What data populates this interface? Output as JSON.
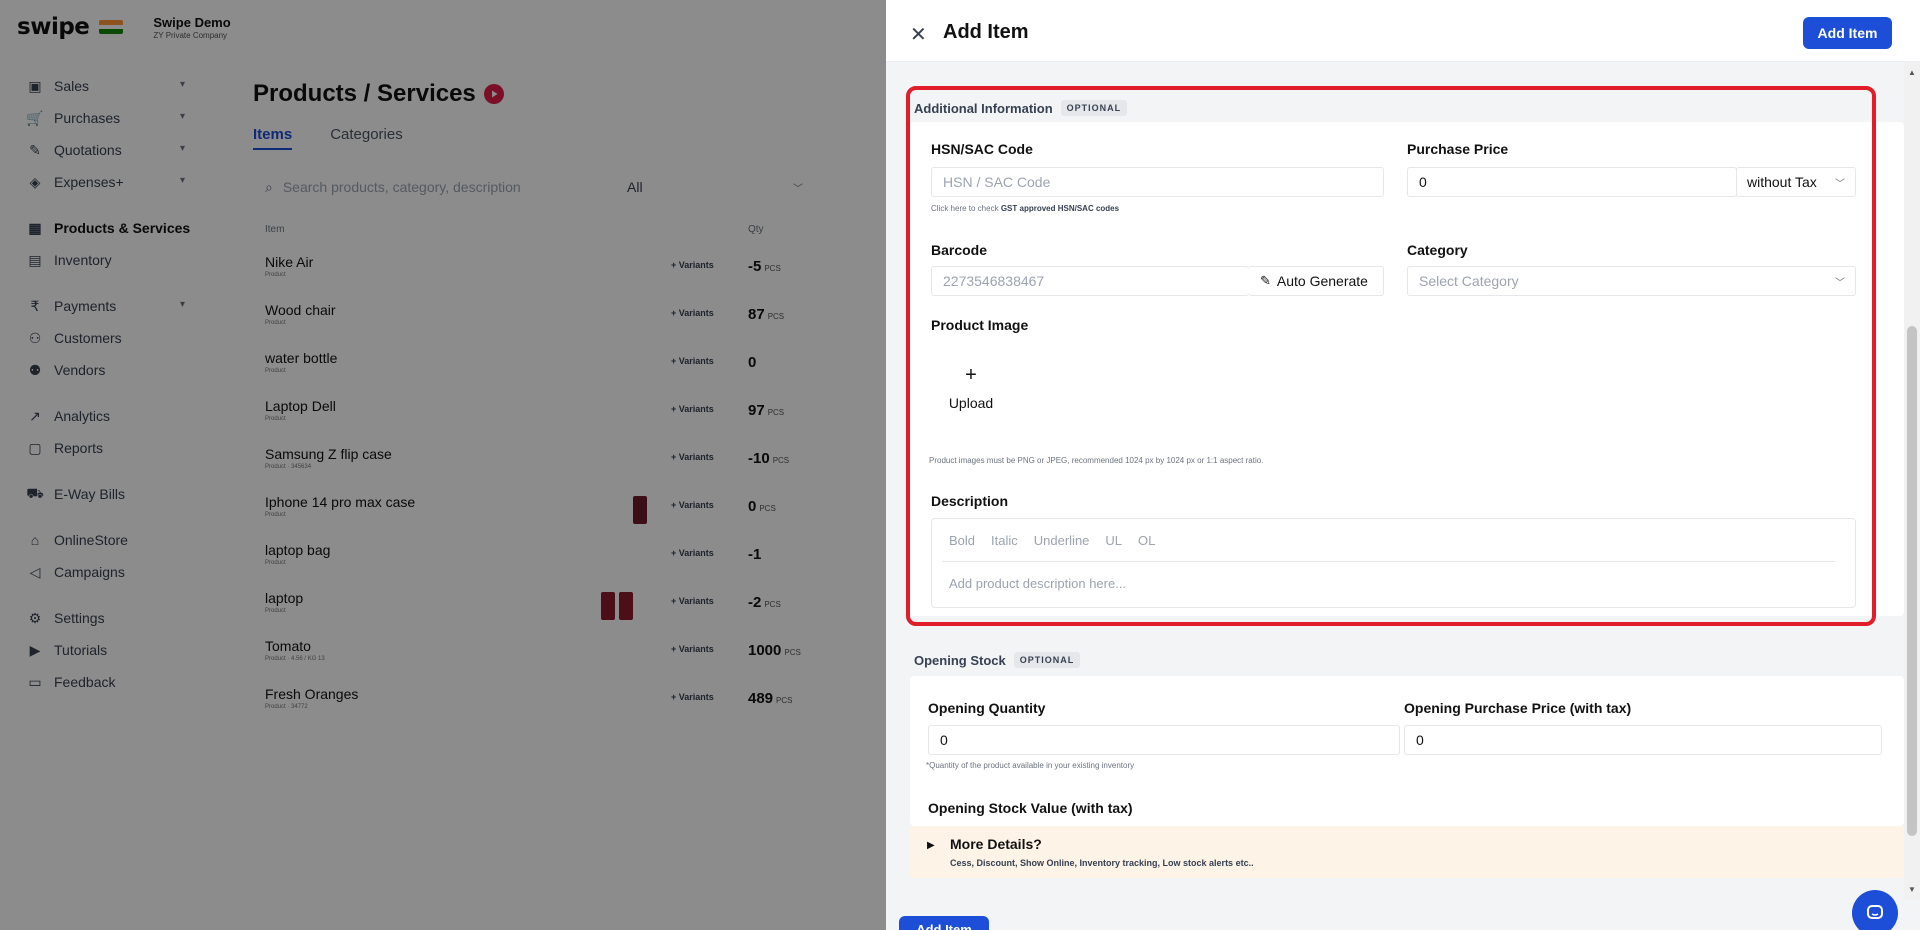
{
  "brand": {
    "logo": "swipe",
    "org_name": "Swipe Demo",
    "org_sub": "ZY Private Company"
  },
  "sidebar": {
    "items": [
      {
        "label": "Sales",
        "icon": "sales-icon",
        "chevron": true
      },
      {
        "label": "Purchases",
        "icon": "cart-icon",
        "chevron": true
      },
      {
        "label": "Quotations",
        "icon": "pen-icon",
        "chevron": true
      },
      {
        "label": "Expenses+",
        "icon": "tag-icon",
        "chevron": true
      },
      {
        "label": "Products & Services",
        "icon": "products-icon",
        "active": true
      },
      {
        "label": "Inventory",
        "icon": "inventory-icon"
      },
      {
        "label": "Payments",
        "icon": "rupee-icon",
        "chevron": true
      },
      {
        "label": "Customers",
        "icon": "user-icon"
      },
      {
        "label": "Vendors",
        "icon": "users-icon"
      },
      {
        "label": "Analytics",
        "icon": "chart-icon"
      },
      {
        "label": "Reports",
        "icon": "report-icon"
      },
      {
        "label": "E-Way Bills",
        "icon": "truck-icon"
      },
      {
        "label": "OnlineStore",
        "icon": "store-icon"
      },
      {
        "label": "Campaigns",
        "icon": "megaphone-icon"
      },
      {
        "label": "Settings",
        "icon": "gear-icon"
      },
      {
        "label": "Tutorials",
        "icon": "youtube-icon"
      },
      {
        "label": "Feedback",
        "icon": "chat-icon"
      }
    ]
  },
  "products_page": {
    "title": "Products / Services",
    "tabs": [
      "Items",
      "Categories"
    ],
    "search_placeholder": "Search products, category, description",
    "filter_value": "All",
    "columns": {
      "item": "Item",
      "qty": "Qty"
    },
    "variants_label": "+ Variants",
    "rows": [
      {
        "name": "Nike Air",
        "sub": "Product",
        "qty": "-5",
        "unit": "PCS"
      },
      {
        "name": "Wood chair",
        "sub": "Product",
        "qty": "87",
        "unit": "PCS"
      },
      {
        "name": "water bottle",
        "sub": "Product",
        "qty": "0",
        "unit": ""
      },
      {
        "name": "Laptop Dell",
        "sub": "Product",
        "qty": "97",
        "unit": "PCS"
      },
      {
        "name": "Samsung Z flip case",
        "sub": "Product · 345634",
        "qty": "-10",
        "unit": "PCS"
      },
      {
        "name": "Iphone 14 pro max case",
        "sub": "Product",
        "qty": "0",
        "unit": "PCS"
      },
      {
        "name": "laptop bag",
        "sub": "Product",
        "qty": "-1",
        "unit": ""
      },
      {
        "name": "laptop",
        "sub": "Product",
        "qty": "-2",
        "unit": "PCS"
      },
      {
        "name": "Tomato",
        "sub": "Product · 4.56 / KG 13",
        "qty": "1000",
        "unit": "PCS"
      },
      {
        "name": "Fresh Oranges",
        "sub": "Product · 34772",
        "qty": "489",
        "unit": "PCS"
      }
    ]
  },
  "drawer": {
    "title": "Add Item",
    "add_button": "Add Item",
    "additional_info": {
      "heading": "Additional Information",
      "badge": "OPTIONAL",
      "hsn_label": "HSN/SAC Code",
      "hsn_placeholder": "HSN / SAC Code",
      "hsn_hint_pre": "Click here to check",
      "hsn_hint_bold": "GST approved HSN/SAC codes",
      "purchase_label": "Purchase Price",
      "purchase_value": "0",
      "tax_option": "without Tax",
      "barcode_label": "Barcode",
      "barcode_placeholder": "2273546838467",
      "auto_generate": "Auto Generate",
      "category_label": "Category",
      "category_placeholder": "Select Category",
      "image_label": "Product Image",
      "upload_label": "Upload",
      "image_hint": "Product images must be PNG or JPEG, recommended 1024 px by 1024 px or 1:1 aspect ratio.",
      "description_label": "Description",
      "toolbar": [
        "Bold",
        "Italic",
        "Underline",
        "UL",
        "OL"
      ],
      "description_placeholder": "Add product description here..."
    },
    "opening_stock": {
      "heading": "Opening Stock",
      "badge": "OPTIONAL",
      "qty_label": "Opening Quantity",
      "qty_value": "0",
      "qty_hint": "*Quantity of the product available in your existing inventory",
      "price_label": "Opening Purchase Price (with tax)",
      "price_value": "0",
      "stock_value_label": "Opening Stock Value (with tax)"
    },
    "more_details": {
      "title": "More Details?",
      "desc": "Cess, Discount, Show Online, Inventory tracking, Low stock alerts etc.."
    },
    "bottom_add_button": "Add Item"
  },
  "colors": {
    "primary": "#1d4ed8",
    "highlight": "#e11d2a",
    "more_bg": "#fdf3e7"
  }
}
